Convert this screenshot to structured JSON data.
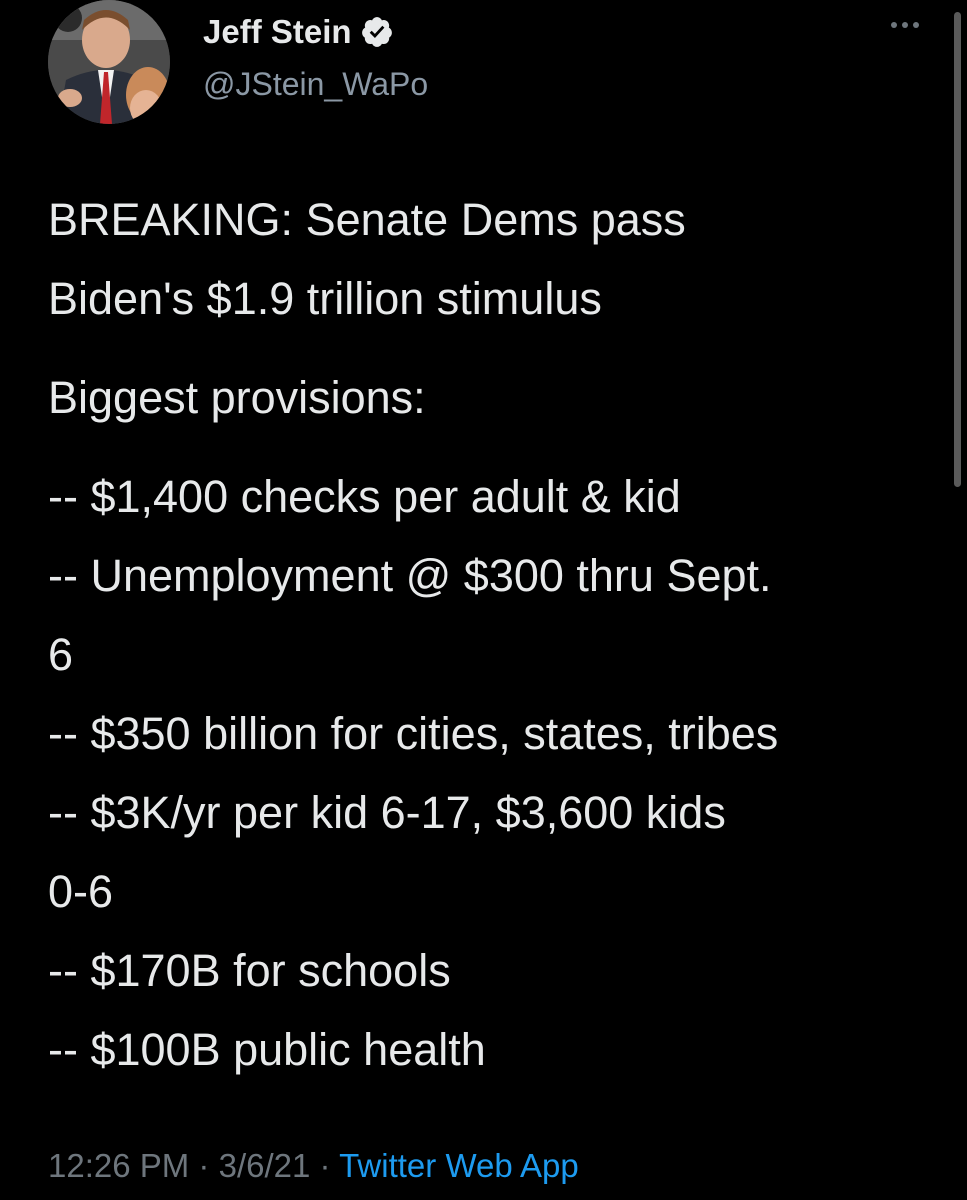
{
  "tweet": {
    "author": {
      "display_name": "Jeff Stein",
      "handle": "@JStein_WaPo",
      "verified_icon": "verified-badge-icon"
    },
    "more_icon": "more-options-icon",
    "text": {
      "headline_line1": "BREAKING: Senate Dems pass",
      "headline_line2": "Biden's $1.9 trillion stimulus",
      "intro": "Biggest provisions:",
      "items": [
        "-- $1,400 checks per adult & kid",
        "-- Unemployment @ $300 thru Sept.",
        "6",
        "-- $350 billion for cities, states, tribes",
        "-- $3K/yr per kid 6-17, $3,600 kids",
        "0-6",
        "-- $170B for schools",
        "-- $100B public health"
      ]
    },
    "time": "12:26 PM",
    "separator": "·",
    "date": "3/6/21",
    "source": "Twitter Web App"
  },
  "colors": {
    "background": "#000000",
    "text": "#e7e9ea",
    "secondary": "#8b98a5",
    "link": "#1d9bf0"
  }
}
